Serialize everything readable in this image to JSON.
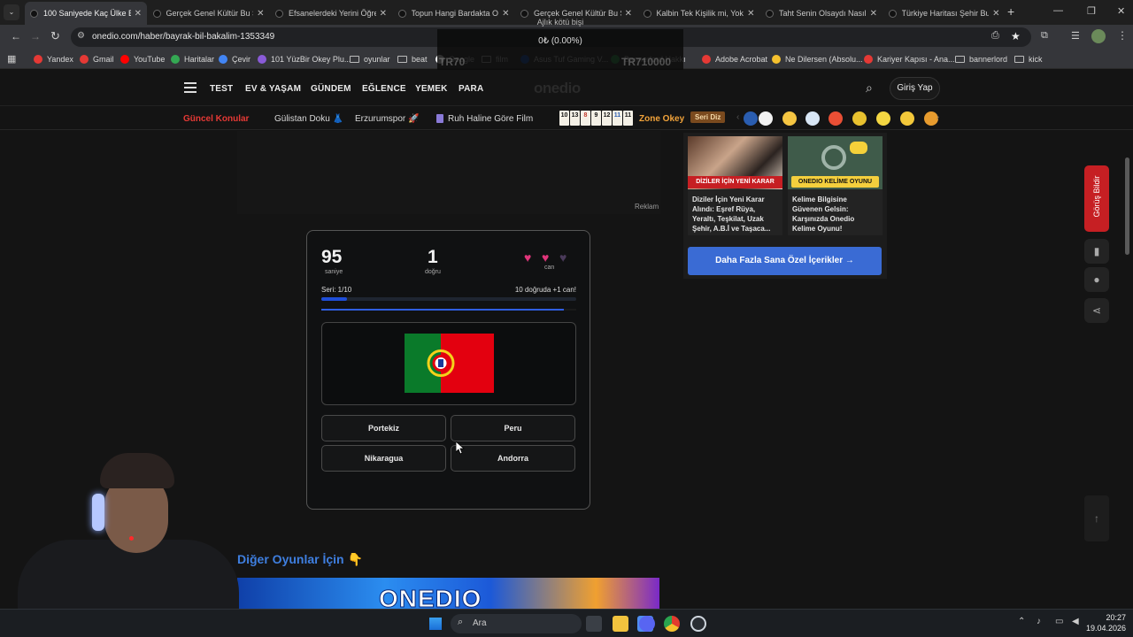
{
  "browser": {
    "tabs": [
      {
        "title": "100 Saniyede Kaç Ülke Bi",
        "active": true
      },
      {
        "title": "Gerçek Genel Kültür Bu Sı",
        "active": false
      },
      {
        "title": "Efsanelerdeki Yerini Öğren",
        "active": false
      },
      {
        "title": "Topun Hangi Bardakta Old",
        "active": false
      },
      {
        "title": "Gerçek Genel Kültür Bu Sı",
        "active": false
      },
      {
        "title": "Kalbin Tek Kişilik mi, Yoksa",
        "active": false
      },
      {
        "title": "Taht Senin Olsaydı Nasıl B",
        "active": false
      },
      {
        "title": "Türkiye Haritası Şehir Bulı",
        "active": false
      }
    ],
    "new_tab": "+",
    "url": "onedio.com/haber/bayrak-bil-bakalim-1353349",
    "bookmarks": [
      "Yandex",
      "Gmail",
      "YouTube",
      "Haritalar",
      "Çevir",
      "101 YüzBir Okey Plu...",
      "oyunlar",
      "beat",
      "Google",
      "film",
      "Asus Tuf Gaming V...",
      "Bannerlord Hakkı",
      "Adobe Acrobat",
      "Ne Dilersen (Absolu...",
      "Kariyer Kapısı - Ana...",
      "bannerlord",
      "kick"
    ]
  },
  "overlay": {
    "line1": "Ajlık kötü bişi",
    "line2": "0₺ (0.00%)",
    "ghost1": "TR70",
    "ghost2": "TR710000"
  },
  "site": {
    "nav": [
      "TEST",
      "EV & YAŞAM",
      "GÜNDEM",
      "EĞLENCE",
      "YEMEK",
      "PARA"
    ],
    "logo": "onedio",
    "login": "Giriş Yap",
    "topics": {
      "label": "Güncel Konular",
      "items": [
        "Gülistan Doku 👗",
        "Erzurumspor 🚀",
        "Ruh Haline Göre Film"
      ]
    },
    "zone_okey": "Zone Okey",
    "seri_diz": "Seri Diz",
    "okey_tiles": [
      "10",
      "13",
      "8",
      "9",
      "12",
      "11",
      "11"
    ],
    "okey_colors": [
      "#111",
      "#111",
      "#c0392b",
      "#111",
      "#111",
      "#2a5db0",
      "#111"
    ],
    "ad_label": "Reklam"
  },
  "game": {
    "time_value": "95",
    "time_label": "saniye",
    "correct_value": "1",
    "correct_label": "doğru",
    "lives_label": "can",
    "lives_total": 3,
    "lives_remaining": 2,
    "streak": "Seri: 1/10",
    "bonus": "10 doğruda +1 can!",
    "streak_progress": 0.1,
    "time_progress": 0.95,
    "flag": "portugal-flag",
    "options": [
      "Portekiz",
      "Peru",
      "Nikaragua",
      "Andorra"
    ]
  },
  "sidebar_panel": {
    "cards": [
      {
        "badge": "DİZİLER İÇİN YENİ KARAR",
        "caption": "Diziler İçin Yeni Karar Alındı: Eşref Rüya, Yeraltı, Teşkilat, Uzak Şehir, A.B.İ ve Taşaca..."
      },
      {
        "badge": "ONEDIO KELİME OYUNU",
        "caption": "Kelime Bilgisine Güvenen Gelsin: Karşınızda Onedio Kelime Oyunu!"
      }
    ],
    "more_button": "Daha Fazla Sana Özel İçerikler →"
  },
  "feedback_label": "Görüş Bildir",
  "other_games": "Diğer Oyunlar İçin 👇",
  "banner_text": "ONEDIO",
  "taskbar": {
    "search": "Ara",
    "time": "20:27",
    "date": "19.04.2026"
  },
  "colors": {
    "accent_blue": "#3a6bd4",
    "heart_pink": "#e0357a",
    "topic_red": "#e53935",
    "zone_orange": "#f2a33a"
  }
}
